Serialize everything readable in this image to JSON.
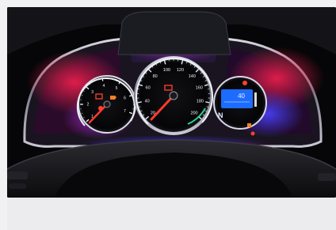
{
  "photo": {
    "subject": "car-instrument-cluster",
    "colors": {
      "backdrop": "#060608",
      "bezel_chrome": "#b9b9c2",
      "ambient_red": "#e0123a",
      "ambient_blue": "#3a3af0",
      "ambient_purple": "#8a2ad0",
      "lcd": "#1e6bff",
      "needle": "#ff3a2a",
      "ring_white": "#e9eef5"
    },
    "speedometer": {
      "ticks": [
        "20",
        "40",
        "60",
        "80",
        "100",
        "120",
        "140",
        "160",
        "180",
        "200"
      ],
      "needle_value": 0
    },
    "tachometer": {
      "ticks": [
        "1",
        "2",
        "3",
        "4",
        "5",
        "6",
        "7"
      ],
      "needle_value": 0
    },
    "display": {
      "reading": "40",
      "gear": "N"
    },
    "icons": [
      "battery-warning-icon",
      "oil-warning-icon",
      "engine-warning-icon",
      "fuel-icon",
      "brake-warning-icon"
    ]
  }
}
